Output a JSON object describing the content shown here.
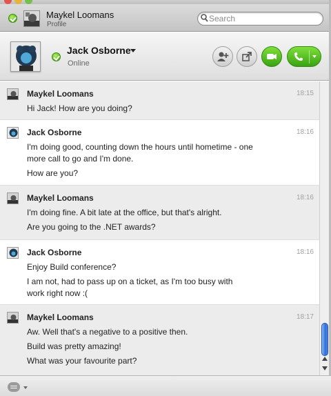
{
  "profile": {
    "name": "Maykel Loomans",
    "subtitle": "Profile"
  },
  "search": {
    "placeholder": "Search",
    "icon": "search-icon"
  },
  "contact": {
    "name": "Jack Osborne",
    "status": "Online",
    "status_color": "#58b81d",
    "actions": [
      "add-contact-icon",
      "share-icon",
      "video-call-icon",
      "phone-call-icon"
    ]
  },
  "colors": {
    "accent_green": "#3aa313",
    "scroll_thumb": "#2f6fd8"
  },
  "messages": [
    {
      "sender": "Maykel Loomans",
      "time": "18:15",
      "lines": [
        "Hi Jack! How are you doing?"
      ]
    },
    {
      "sender": "Jack Osborne",
      "time": "18:16",
      "lines": [
        "I'm doing good, counting down the hours until hometime - one",
        "more call to go and I'm done.",
        "How are you?"
      ]
    },
    {
      "sender": "Maykel Loomans",
      "time": "18:16",
      "lines": [
        "I'm doing fine. A bit late at the office, but that's alright.",
        "Are you going to the .NET awards?"
      ]
    },
    {
      "sender": "Jack Osborne",
      "time": "18:16",
      "lines": [
        "Enjoy Build conference?",
        "I am not, had to pass up on a ticket, as I'm too busy with",
        "work right now :("
      ]
    },
    {
      "sender": "Maykel Loomans",
      "time": "18:17",
      "lines": [
        "Aw. Well that's a negative to a positive then.",
        "Build was pretty amazing!",
        "What was your favourite part?"
      ]
    }
  ]
}
